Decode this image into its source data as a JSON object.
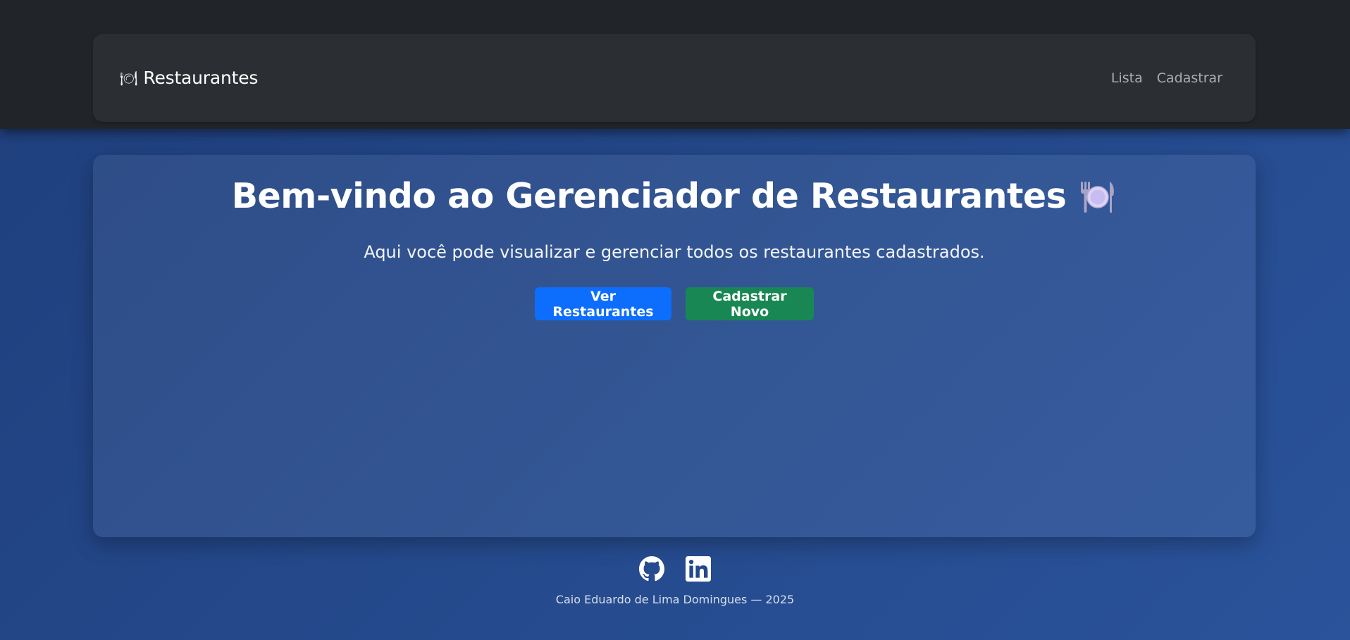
{
  "navbar": {
    "brand_icon": "plate-with-cutlery-icon",
    "brand_text": "Restaurantes",
    "links": [
      {
        "label": "Lista"
      },
      {
        "label": "Cadastrar"
      }
    ]
  },
  "hero": {
    "title": "Bem-vindo ao Gerenciador de Restaurantes",
    "title_icon": "plate-with-cutlery-icon",
    "subtitle": "Aqui você pode visualizar e gerenciar todos os restaurantes cadastrados.",
    "primary_button": "Ver Restaurantes",
    "secondary_button": "Cadastrar Novo"
  },
  "footer": {
    "icons": [
      "github-icon",
      "linkedin-icon"
    ],
    "text": "Caio Eduardo de Lima Domingues — 2025"
  },
  "colors": {
    "navbar_band": "#212529",
    "navbar": "#2b2f33",
    "background": "#24488a",
    "primary": "#0d6efd",
    "success": "#198754"
  }
}
